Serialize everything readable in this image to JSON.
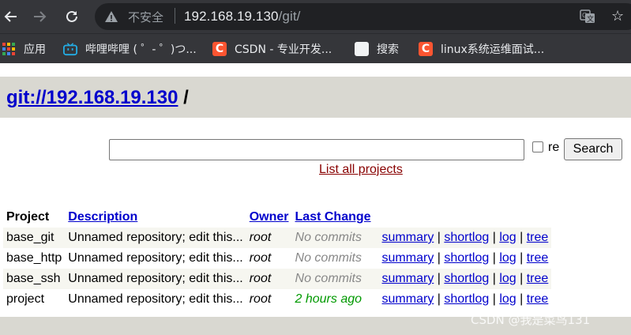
{
  "browser": {
    "security_label": "不安全",
    "url_host": "192.168.19.130",
    "url_path": "/git/",
    "bookmarks": [
      {
        "label": "应用",
        "icon": "apps-grid-icon"
      },
      {
        "label": "哔哩哔哩 ( ゜- ゜)つ...",
        "icon": "bilibili-icon"
      },
      {
        "label": "CSDN - 专业开发...",
        "icon": "csdn-icon"
      },
      {
        "label": "搜索",
        "icon": "blank-page-icon"
      },
      {
        "label": "linux系统运维面试...",
        "icon": "csdn-icon"
      }
    ],
    "csdn_icon_letter": "C"
  },
  "page": {
    "header_link": "git://192.168.19.130",
    "header_suffix": " /",
    "search": {
      "value": "",
      "re_label": "re",
      "button_label": "Search"
    },
    "list_all_label": "List all projects",
    "table": {
      "headers": [
        "Project",
        "Description",
        "Owner",
        "Last Change"
      ],
      "link_sep": " | ",
      "rows": [
        {
          "project": "base_git",
          "description": "Unnamed repository; edit this...",
          "owner": "root",
          "age": "No commits",
          "links": [
            "summary",
            "shortlog",
            "log",
            "tree"
          ]
        },
        {
          "project": "base_http",
          "description": "Unnamed repository; edit this...",
          "owner": "root",
          "age": "No commits",
          "links": [
            "summary",
            "shortlog",
            "log",
            "tree"
          ]
        },
        {
          "project": "base_ssh",
          "description": "Unnamed repository; edit this...",
          "owner": "root",
          "age": "No commits",
          "links": [
            "summary",
            "shortlog",
            "log",
            "tree"
          ]
        },
        {
          "project": "project",
          "description": "Unnamed repository; edit this...",
          "owner": "root",
          "age": "2 hours ago",
          "links": [
            "summary",
            "shortlog",
            "log",
            "tree"
          ]
        }
      ]
    }
  },
  "watermark": "CSDN @我是菜鸟131",
  "colors": {
    "chrome_bg": "#35363a",
    "header_bg": "#d9d8d1",
    "link": "#0000cc",
    "list_all": "#880000",
    "recent_age": "#009900",
    "no_commits": "#888888"
  }
}
